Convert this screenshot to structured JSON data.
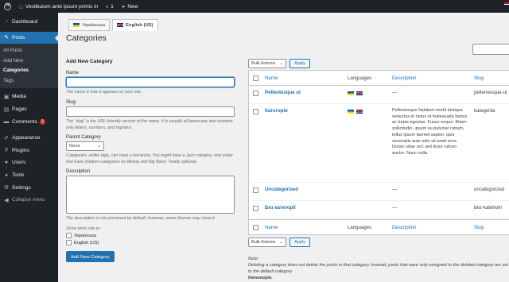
{
  "admin_bar": {
    "site_name": "Vestibulum ante ipsum primis in",
    "comments_count": "1",
    "new_label": "New"
  },
  "sidebar": {
    "items": [
      {
        "label": "Dashboard",
        "icon": "dashboard-icon"
      },
      {
        "label": "Posts",
        "icon": "pin-icon"
      },
      {
        "label": "Media",
        "icon": "media-icon"
      },
      {
        "label": "Pages",
        "icon": "pages-icon"
      },
      {
        "label": "Comments",
        "icon": "comments-icon",
        "badge": "1"
      },
      {
        "label": "Appearance",
        "icon": "brush-icon"
      },
      {
        "label": "Plugins",
        "icon": "plugin-icon"
      },
      {
        "label": "Users",
        "icon": "users-icon"
      },
      {
        "label": "Tools",
        "icon": "wrench-icon"
      },
      {
        "label": "Settings",
        "icon": "settings-icon"
      }
    ],
    "posts_submenu": [
      "All Posts",
      "Add New",
      "Categories",
      "Tags"
    ],
    "collapse_label": "Collapse menu"
  },
  "language_tabs": [
    {
      "label": "Українська",
      "flag": "ua"
    },
    {
      "label": "English (US)",
      "flag": "uk"
    }
  ],
  "page_title": "Categories",
  "form": {
    "heading": "Add New Category",
    "name_label": "Name",
    "name_help": "The name is how it appears on your site.",
    "slug_label": "Slug",
    "slug_help": "The “slug” is the URL-friendly version of the name. It is usually all lowercase and contains only letters, numbers, and hyphens.",
    "parent_label": "Parent Category",
    "parent_value": "None",
    "parent_help": "Categories, unlike tags, can have a hierarchy. You might have a Jazz category, and under that have children categories for Bebop and Big Band. Totally optional.",
    "description_label": "Description",
    "description_help": "The description is not prominent by default; however, some themes may show it.",
    "show_term_label": "Show term only in:",
    "lang_options": [
      "Українська",
      "English (US)"
    ],
    "submit_label": "Add New Category"
  },
  "bulk": {
    "select_value": "Bulk Actions",
    "apply_label": "Apply"
  },
  "table": {
    "columns": {
      "name": "Name",
      "languages": "Languages",
      "description": "Description",
      "slug": "Slug"
    },
    "rows": [
      {
        "name": "Pellentesque ut",
        "flags": [
          "ua",
          "uk"
        ],
        "description": "—",
        "slug": "pellentesque-ut"
      },
      {
        "name": "Категорія",
        "flags": [
          "ua",
          "uk"
        ],
        "description": "Pellentesque habitant morbi tristique senectus et netus et malesuada fames ac turpis egestas. Fusce neque. Etiam sollicitudin, ipsum eu pulvinar rutrum, tellus ipsum laoreet sapien, quis venenatis ante odio sit amet eros. Donec vitae orci sed dolor rutrum auctor. Nunc nulla.",
        "slug": "kategoriia"
      },
      {
        "name": "Uncategorized",
        "flags": [],
        "description": "—",
        "slug": "uncategorized"
      },
      {
        "name": "Без категорії",
        "flags": [],
        "description": "—",
        "slug": "bez-katehorii"
      }
    ]
  },
  "note": {
    "label": "Note:",
    "text": "Deleting a category does not delete the posts in that category. Instead, posts that were only assigned to the deleted category are set to the default category",
    "default_category": "Категорія."
  }
}
